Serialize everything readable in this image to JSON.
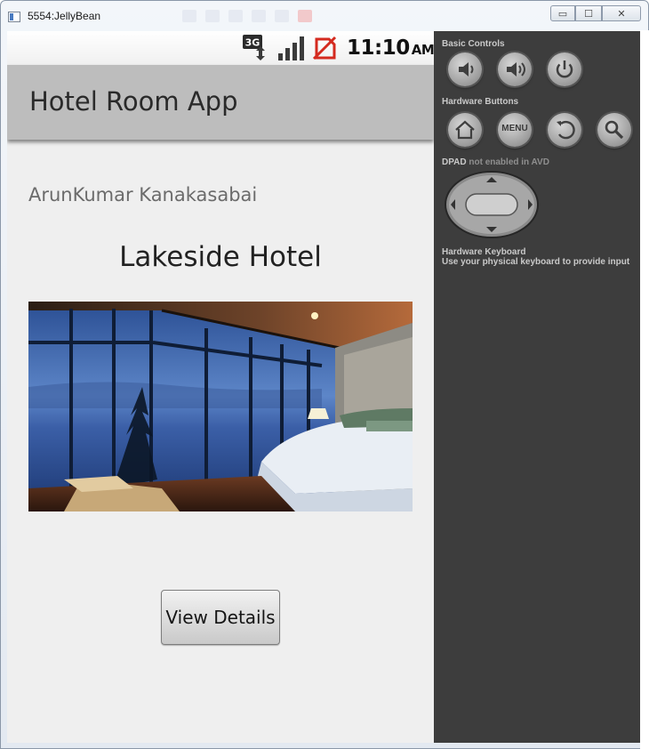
{
  "window": {
    "title": "5554:JellyBean",
    "buttons": {
      "minimize": "▭",
      "maximize": "☐",
      "close": "✕"
    }
  },
  "statusbar": {
    "network_icon": "3g-data-icon",
    "signal_icon": "signal-strength-icon",
    "sim_icon": "no-sim-icon",
    "time": "11:10",
    "ampm": "AM"
  },
  "app": {
    "title": "Hotel Room App",
    "author": "ArunKumar Kanakasabai",
    "hotel_name": "Lakeside Hotel",
    "photo_icon": "hotel-room-photo",
    "button_label": "View Details"
  },
  "controls": {
    "basic_label": "Basic Controls",
    "basic_buttons": [
      "volume-down-icon",
      "volume-up-icon",
      "power-icon"
    ],
    "hardware_label": "Hardware Buttons",
    "hardware_buttons": [
      "home-icon",
      "menu-button",
      "back-icon",
      "search-icon"
    ],
    "menu_text": "MENU",
    "dpad_label": "DPAD",
    "dpad_status": "not enabled in AVD",
    "keyboard_label": "Hardware Keyboard",
    "keyboard_hint": "Use your physical keyboard to provide input"
  }
}
